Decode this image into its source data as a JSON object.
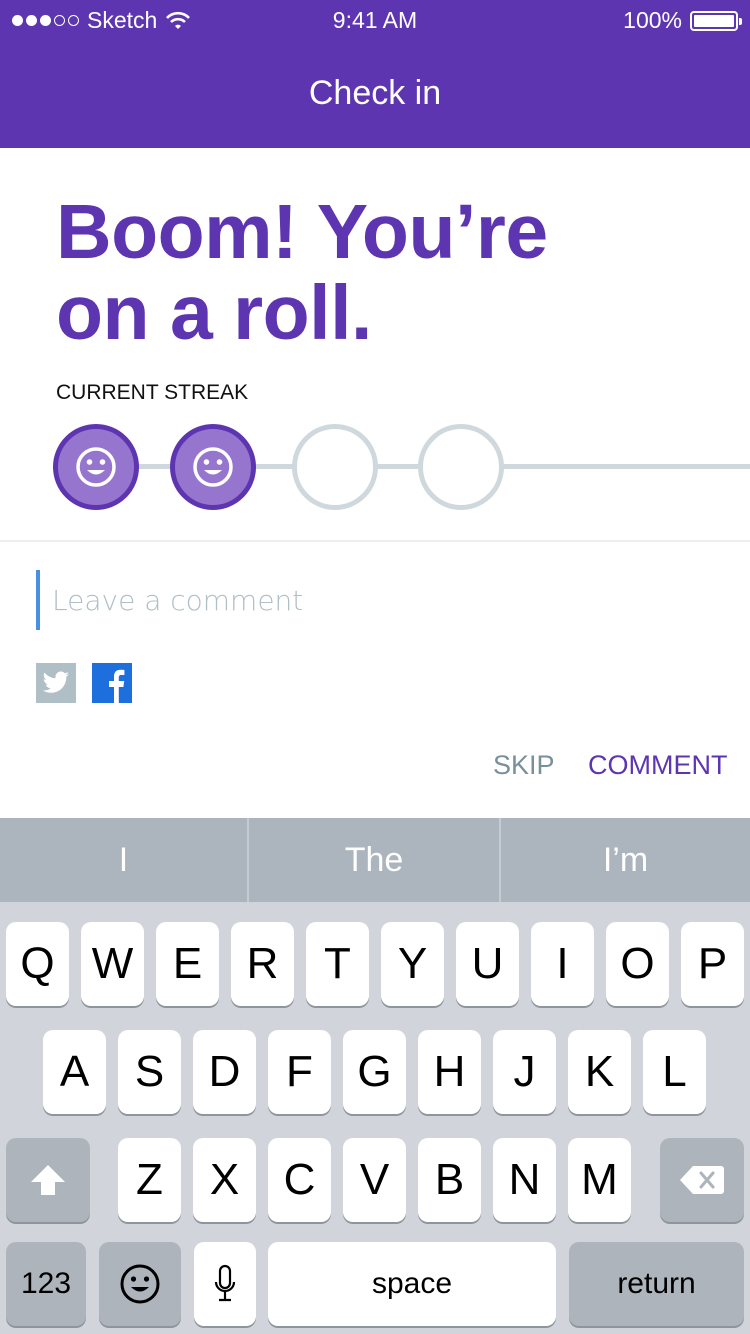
{
  "status_bar": {
    "carrier": "Sketch",
    "time": "9:41 AM",
    "battery": "100%"
  },
  "nav": {
    "title": "Check in"
  },
  "hero": {
    "headline_line1": "Boom! You’re",
    "headline_line2": "on a roll."
  },
  "streak": {
    "label": "CURRENT STREAK",
    "completed": 2,
    "total": 4
  },
  "comment": {
    "placeholder": "Leave a comment",
    "value": ""
  },
  "social": [
    "twitter-icon",
    "facebook-icon"
  ],
  "actions": {
    "skip": "SKIP",
    "comment": "COMMENT"
  },
  "colors": {
    "primary": "#5e35b1",
    "primary_light": "#9575cd",
    "track": "#cfd8dc",
    "caret": "#4a90e2"
  },
  "keyboard": {
    "predictions": [
      "I",
      "The",
      "I’m"
    ],
    "row1": [
      "Q",
      "W",
      "E",
      "R",
      "T",
      "Y",
      "U",
      "I",
      "O",
      "P"
    ],
    "row2": [
      "A",
      "S",
      "D",
      "F",
      "G",
      "H",
      "J",
      "K",
      "L"
    ],
    "row3": [
      "Z",
      "X",
      "C",
      "V",
      "B",
      "N",
      "M"
    ],
    "numbers_label": "123",
    "space_label": "space",
    "return_label": "return"
  }
}
